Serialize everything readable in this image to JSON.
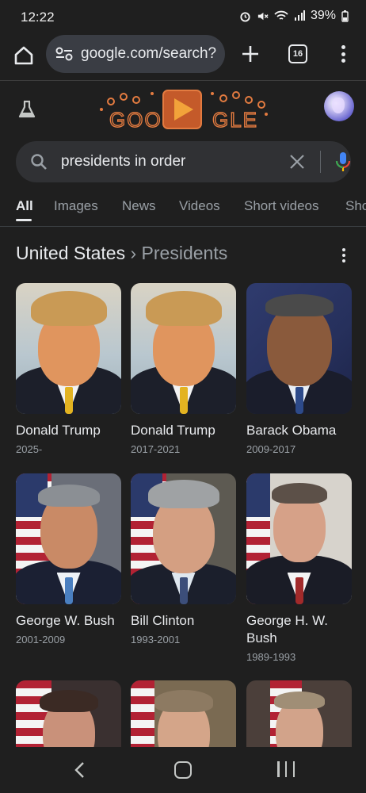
{
  "status_bar": {
    "time": "12:22",
    "battery": "39%"
  },
  "browser": {
    "url": "google.com/search?",
    "tab_count": "16"
  },
  "google": {
    "doodle_letters": "GOOGLE"
  },
  "search": {
    "query": "presidents in order"
  },
  "tabs": [
    {
      "label": "All",
      "active": true
    },
    {
      "label": "Images",
      "active": false
    },
    {
      "label": "News",
      "active": false
    },
    {
      "label": "Videos",
      "active": false
    },
    {
      "label": "Short videos",
      "active": false
    },
    {
      "label": "Sho",
      "active": false
    }
  ],
  "results": {
    "breadcrumb_root": "United States",
    "separator": "›",
    "breadcrumb_sub": "Presidents",
    "presidents": [
      {
        "name": "Donald Trump",
        "years": "2025-"
      },
      {
        "name": "Donald Trump",
        "years": "2017-2021"
      },
      {
        "name": "Barack Obama",
        "years": "2009-2017"
      },
      {
        "name": "George W. Bush",
        "years": "2001-2009"
      },
      {
        "name": "Bill Clinton",
        "years": "1993-2001"
      },
      {
        "name": "George H. W. Bush",
        "years": "1989-1993"
      },
      {
        "name": "",
        "years": ""
      },
      {
        "name": "",
        "years": ""
      },
      {
        "name": "",
        "years": ""
      }
    ]
  },
  "colors": {
    "background": "#1f1f1f",
    "surface": "#303134",
    "url_pill": "#3a3d44",
    "text_primary": "#e8eaed",
    "text_secondary": "#9aa0a6",
    "mic_blue": "#4285f4",
    "mic_red": "#ea4335"
  },
  "icons": [
    "home-icon",
    "tune-icon",
    "plus-icon",
    "tabs-icon",
    "more-vert-icon",
    "flask-icon",
    "search-icon",
    "close-icon",
    "mic-icon",
    "back-icon",
    "home-nav-icon",
    "recents-icon"
  ]
}
